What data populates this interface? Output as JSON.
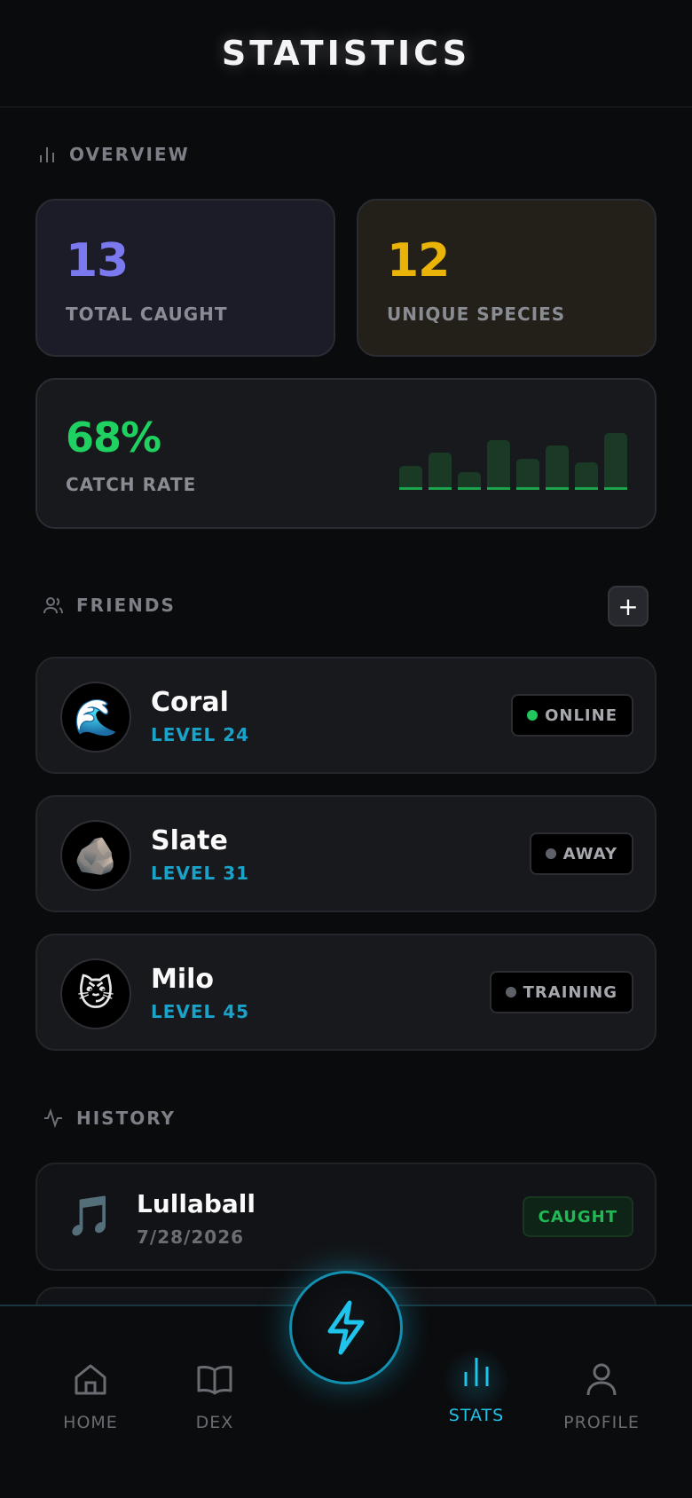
{
  "header": {
    "title": "STATISTICS"
  },
  "overview": {
    "label": "OVERVIEW",
    "total_caught": {
      "value": "13",
      "label": "TOTAL CAUGHT",
      "color": "#7b79f0"
    },
    "unique_species": {
      "value": "12",
      "label": "UNIQUE SPECIES",
      "color": "#eab308"
    },
    "catch_rate": {
      "value": "68%",
      "label": "CATCH RATE",
      "color": "#1fd160",
      "bars": [
        0.42,
        0.66,
        0.32,
        0.88,
        0.54,
        0.78,
        0.48,
        1.0
      ]
    }
  },
  "friends": {
    "label": "FRIENDS",
    "add_label": "+",
    "items": [
      {
        "name": "Coral",
        "level": "LEVEL 24",
        "avatar": "🌊",
        "status": "ONLINE",
        "status_color": "#22c55e"
      },
      {
        "name": "Slate",
        "level": "LEVEL 31",
        "avatar": "🪨",
        "status": "AWAY",
        "status_color": "#5f6168"
      },
      {
        "name": "Milo",
        "level": "LEVEL 45",
        "avatar": "😼",
        "status": "TRAINING",
        "status_color": "#5f6168"
      }
    ]
  },
  "history": {
    "label": "HISTORY",
    "items": [
      {
        "name": "Lullaball",
        "date": "7/28/2026",
        "icon": "🎵",
        "status": "CAUGHT"
      }
    ]
  },
  "nav": {
    "items": [
      {
        "label": "HOME",
        "icon": "home-icon"
      },
      {
        "label": "DEX",
        "icon": "book-icon"
      },
      {
        "label": "STATS",
        "icon": "bar-chart-icon",
        "active": true
      },
      {
        "label": "PROFILE",
        "icon": "user-icon"
      }
    ],
    "fab_icon": "lightning-icon",
    "accent": "#1ec4ec"
  }
}
